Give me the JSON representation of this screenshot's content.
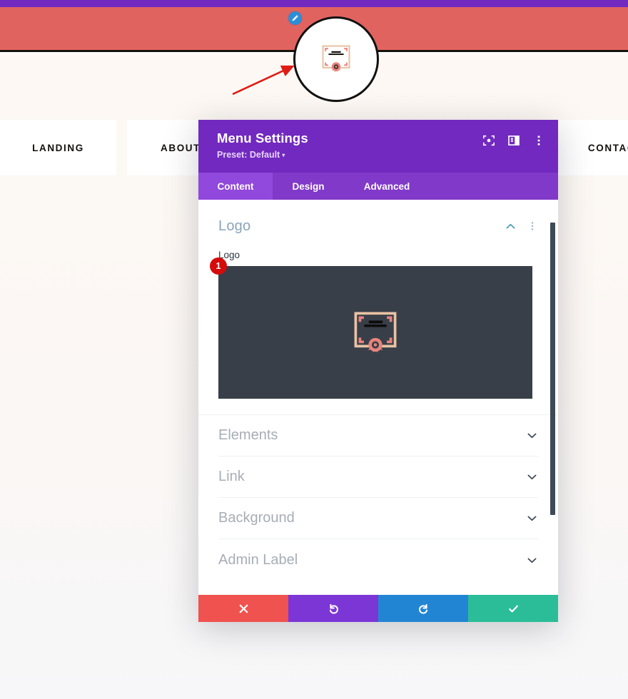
{
  "site": {
    "logo_alt": "certificate-logo",
    "edit_badge_icon": "pencil-edit-icon",
    "annotation_icon": "red-arrow-annotation",
    "nav": [
      {
        "label": "LANDING",
        "name": "nav-item-landing"
      },
      {
        "label": "ABOUT",
        "name": "nav-item-about"
      },
      {
        "label": "CONTACT",
        "name": "nav-item-contact"
      }
    ],
    "colors": {
      "topbar": "#7229bf",
      "hero": "#e1635f",
      "nav_item_bg": "#ffffff"
    }
  },
  "modal": {
    "title": "Menu Settings",
    "preset_label": "Preset: Default",
    "preset_caret": "▾",
    "header_icons": [
      {
        "name": "focus-target-icon"
      },
      {
        "name": "panel-layout-icon"
      },
      {
        "name": "more-vertical-icon"
      }
    ],
    "tabs": [
      {
        "label": "Content",
        "name": "tab-content",
        "active": true
      },
      {
        "label": "Design",
        "name": "tab-design",
        "active": false
      },
      {
        "label": "Advanced",
        "name": "tab-advanced",
        "active": false
      }
    ],
    "open_section": {
      "title": "Logo",
      "collapse_icon": "chevron-up-icon",
      "menu_icon": "more-vertical-icon",
      "field_label": "Logo",
      "image_badge_count": "1",
      "image_alt": "certificate-logo-preview"
    },
    "collapsed_sections": [
      {
        "label": "Elements",
        "name": "section-elements"
      },
      {
        "label": "Link",
        "name": "section-link"
      },
      {
        "label": "Background",
        "name": "section-background"
      },
      {
        "label": "Admin Label",
        "name": "section-admin-label"
      }
    ],
    "footer_buttons": [
      {
        "name": "cancel-button",
        "icon": "close-x-icon",
        "color": "#f0524f"
      },
      {
        "name": "undo-button",
        "icon": "undo-icon",
        "color": "#7c36d6"
      },
      {
        "name": "redo-button",
        "icon": "redo-icon",
        "color": "#2285d3"
      },
      {
        "name": "save-button",
        "icon": "checkmark-icon",
        "color": "#2bbd98"
      }
    ],
    "colors": {
      "header": "#7229bf",
      "tabbar": "#8139c9",
      "tab_active": "#9148dd",
      "section_title": "#8aa4bd",
      "preview_bg": "#383f49",
      "badge": "#d60b0b"
    }
  }
}
